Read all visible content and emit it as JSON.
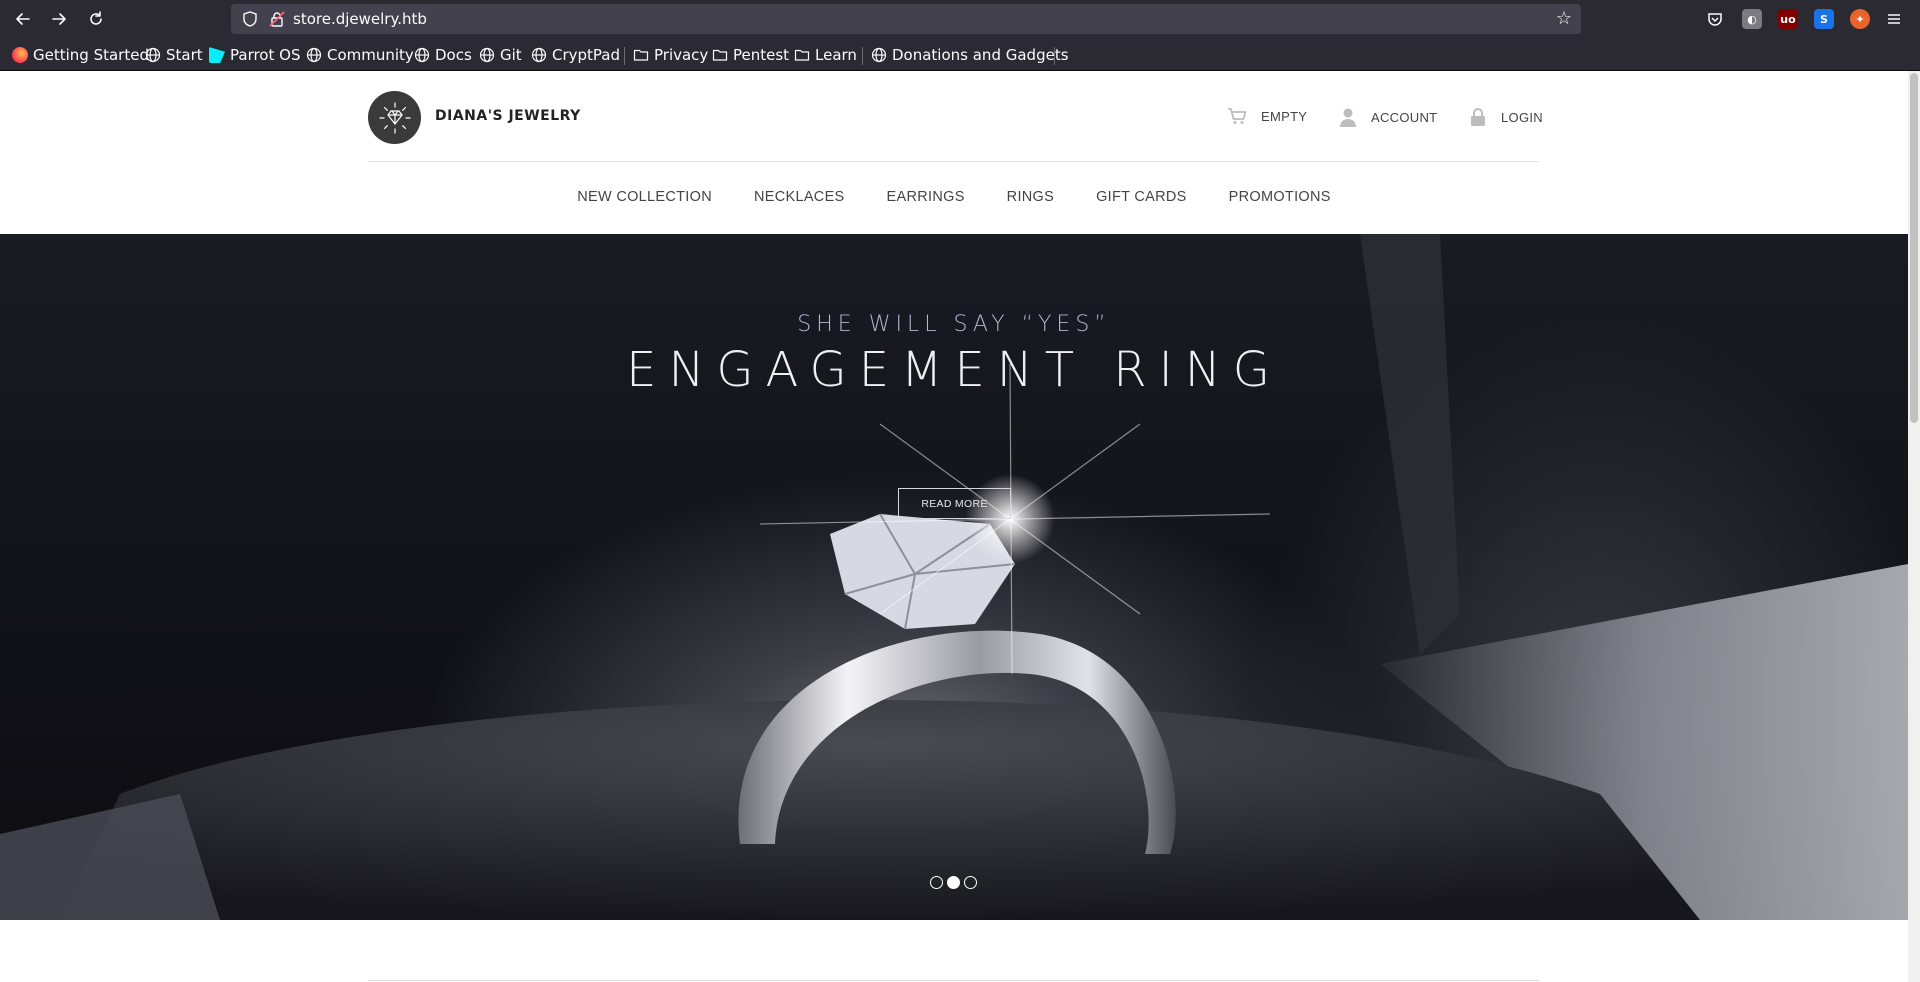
{
  "browser": {
    "url": "store.djewelry.htb",
    "bookmarks": [
      {
        "label": "Getting Started",
        "icon": "firefox-icon"
      },
      {
        "label": "Start",
        "icon": "globe-icon"
      },
      {
        "label": "Parrot OS",
        "icon": "parrot-icon"
      },
      {
        "label": "Community",
        "icon": "globe-icon"
      },
      {
        "label": "Docs",
        "icon": "globe-icon"
      },
      {
        "label": "Git",
        "icon": "globe-icon"
      },
      {
        "label": "CryptPad",
        "icon": "globe-icon"
      },
      {
        "label": "Privacy",
        "icon": "folder-icon"
      },
      {
        "label": "Pentest",
        "icon": "folder-icon"
      },
      {
        "label": "Learn",
        "icon": "folder-icon"
      },
      {
        "label": "Donations and Gadgets",
        "icon": "globe-icon"
      }
    ]
  },
  "site": {
    "brand": "DIANA'S JEWELRY",
    "header_links": {
      "cart": "EMPTY",
      "account": "ACCOUNT",
      "login": "LOGIN"
    },
    "nav": [
      "NEW COLLECTION",
      "NECKLACES",
      "EARRINGS",
      "RINGS",
      "GIFT CARDS",
      "PROMOTIONS"
    ]
  },
  "hero": {
    "subtitle": "SHE WILL SAY “YES”",
    "title": "ENGAGEMENT RING",
    "button": "READ MORE",
    "slides": 3,
    "active_slide": 2
  },
  "colors": {
    "chrome_bg": "#2b2a33",
    "urlbar_bg": "#42414d",
    "text_dark": "#444444",
    "hero_subtitle": "#b6b4d0"
  }
}
